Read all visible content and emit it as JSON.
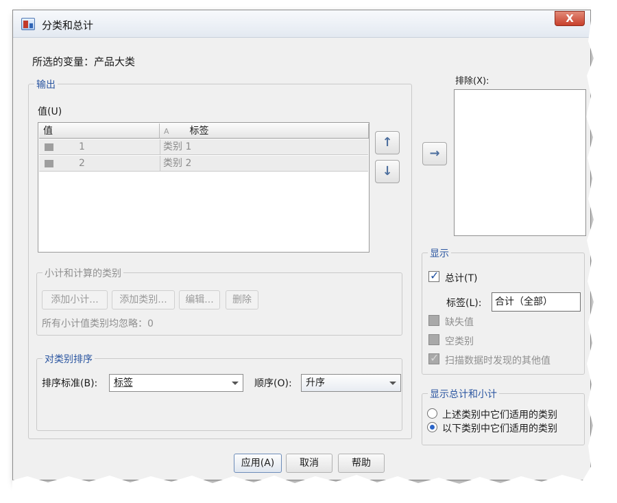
{
  "window": {
    "title": "分类和总计",
    "close_label": "X"
  },
  "selected_variable": {
    "label": "所选的变量：",
    "value": "产品大类"
  },
  "output": {
    "legend": "输出",
    "values_label": "值(U)",
    "table": {
      "columns": [
        "值",
        "标签"
      ],
      "label_header_icon": "A",
      "rows": [
        {
          "value": "1",
          "label": "类别 1"
        },
        {
          "value": "2",
          "label": "类别 2"
        }
      ]
    },
    "subtotals": {
      "legend": "小计和计算的类别",
      "buttons": [
        "添加小计...",
        "添加类别...",
        "编辑...",
        "删除"
      ],
      "status": "所有小计值类别均忽略：0"
    },
    "sort": {
      "legend": "对类别排序",
      "sort_by_label": "排序标准(B):",
      "sort_by_value": "标签",
      "order_label": "顺序(O):",
      "order_value": "升序"
    }
  },
  "exclude": {
    "label": "排除(X):"
  },
  "display": {
    "legend": "显示",
    "total_label": "总计(T)",
    "total_checked": true,
    "label_label": "标签(L):",
    "label_value": "合计（全部）",
    "missing_label": "缺失值",
    "empty_label": "空类别",
    "other_label": "扫描数据时发现的其他值"
  },
  "display_totals": {
    "legend": "显示总计和小计",
    "option_above": "上述类别中它们适用的类别",
    "option_below": "以下类别中它们适用的类别",
    "selected": "below"
  },
  "footer": {
    "apply": "应用(A)",
    "cancel": "取消",
    "help": "帮助"
  },
  "icons": {
    "move_up": "arrow-up-icon",
    "move_down": "arrow-down-icon",
    "move_right": "arrow-right-icon",
    "app": "spss-app-icon"
  }
}
